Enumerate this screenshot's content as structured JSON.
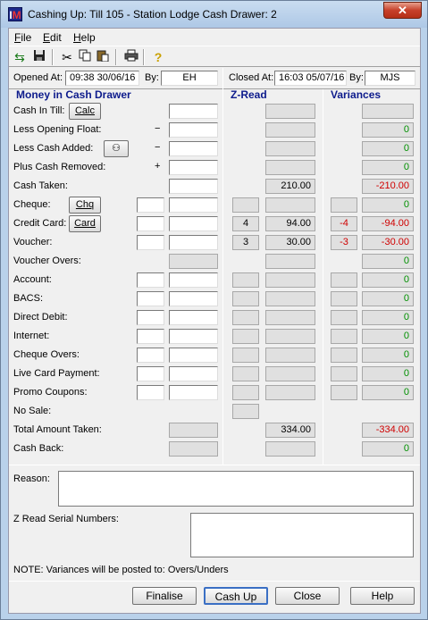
{
  "window": {
    "title": "Cashing Up: Till 105 - Station Lodge  Cash Drawer: 2",
    "close": "✕"
  },
  "menu": [
    "File",
    "Edit",
    "Help"
  ],
  "toolbar": [
    "back-forward-icon",
    "save-icon",
    "cut-icon",
    "copy-icon",
    "paste-icon",
    "print-icon",
    "help-icon"
  ],
  "info": {
    "opened_label": "Opened At:",
    "opened_value": "09:38 30/06/16",
    "by_label": "By:",
    "opened_by": "EH",
    "closed_label": "Closed At:",
    "closed_value": "16:03 05/07/16",
    "by2_label": "By:",
    "closed_by": "MJS"
  },
  "sections": {
    "money": "Money in Cash Drawer",
    "zread": "Z-Read",
    "variances": "Variances"
  },
  "rows": [
    {
      "label": "Cash In Till:",
      "btn": "Calc",
      "cnt": false,
      "amt": true,
      "zcnt": false,
      "zval": "",
      "vcnt": false,
      "vval": ""
    },
    {
      "label": "Less Opening Float:",
      "sign": "−",
      "amt": true,
      "zval": "",
      "vval": "0"
    },
    {
      "label": "Less Cash Added:",
      "sign": "−",
      "icon": "binoculars-icon",
      "amt": true,
      "zval": "",
      "vval": "0"
    },
    {
      "label": "Plus Cash Removed:",
      "sign": "+",
      "amt": true,
      "zval": "",
      "vval": "0"
    },
    {
      "label": "Cash Taken:",
      "amt": true,
      "zval": "210.00",
      "vval": "-210.00"
    },
    {
      "label": "Cheque:",
      "btn": "Chq",
      "cnt": true,
      "amt": true,
      "zcnt": "",
      "zval": "",
      "vcnt": "",
      "vval": "0"
    },
    {
      "label": "Credit Card:",
      "btn": "Card",
      "cnt": true,
      "amt": true,
      "zcnt": "4",
      "zval": "94.00",
      "vcnt": "-4",
      "vval": "-94.00"
    },
    {
      "label": "Voucher:",
      "cnt": true,
      "amt": true,
      "zcnt": "3",
      "zval": "30.00",
      "vcnt": "-3",
      "vval": "-30.00"
    },
    {
      "label": "Voucher Overs:",
      "amtro": true,
      "zval": "",
      "vval": "0"
    },
    {
      "label": "Account:",
      "cnt": true,
      "amt": true,
      "zcnt": "",
      "zval": "",
      "vcnt": "",
      "vval": "0"
    },
    {
      "label": "BACS:",
      "cnt": true,
      "amt": true,
      "zcnt": "",
      "zval": "",
      "vcnt": "",
      "vval": "0"
    },
    {
      "label": "Direct Debit:",
      "cnt": true,
      "amt": true,
      "zcnt": "",
      "zval": "",
      "vcnt": "",
      "vval": "0"
    },
    {
      "label": "Internet:",
      "cnt": true,
      "amt": true,
      "zcnt": "",
      "zval": "",
      "vcnt": "",
      "vval": "0"
    },
    {
      "label": "Cheque Overs:",
      "cnt": true,
      "amt": true,
      "zcnt": "",
      "zval": "",
      "vcnt": "",
      "vval": "0"
    },
    {
      "label": "Live Card Payment:",
      "cnt": true,
      "amt": true,
      "zcnt": "",
      "zval": "",
      "vcnt": "",
      "vval": "0"
    },
    {
      "label": "Promo Coupons:",
      "cnt": true,
      "amt": true,
      "zcnt": "",
      "zval": "",
      "vcnt": "",
      "vval": "0"
    },
    {
      "label": "No Sale:",
      "zcnt": ""
    },
    {
      "label": "Total Amount Taken:",
      "amtro": true,
      "zval": "334.00",
      "vval": "-334.00"
    },
    {
      "label": "Cash Back:",
      "amtro": true,
      "zval": "",
      "vval": "0"
    }
  ],
  "reason_label": "Reason:",
  "serial_label": "Z Read Serial Numbers:",
  "note": "NOTE: Variances will be posted to: Overs/Unders",
  "buttons": [
    "Finalise",
    "Cash Up",
    "Close",
    "Help"
  ],
  "colors": {
    "negative": "#d00000",
    "positive": "#009000",
    "section": "#0d1b8c"
  }
}
